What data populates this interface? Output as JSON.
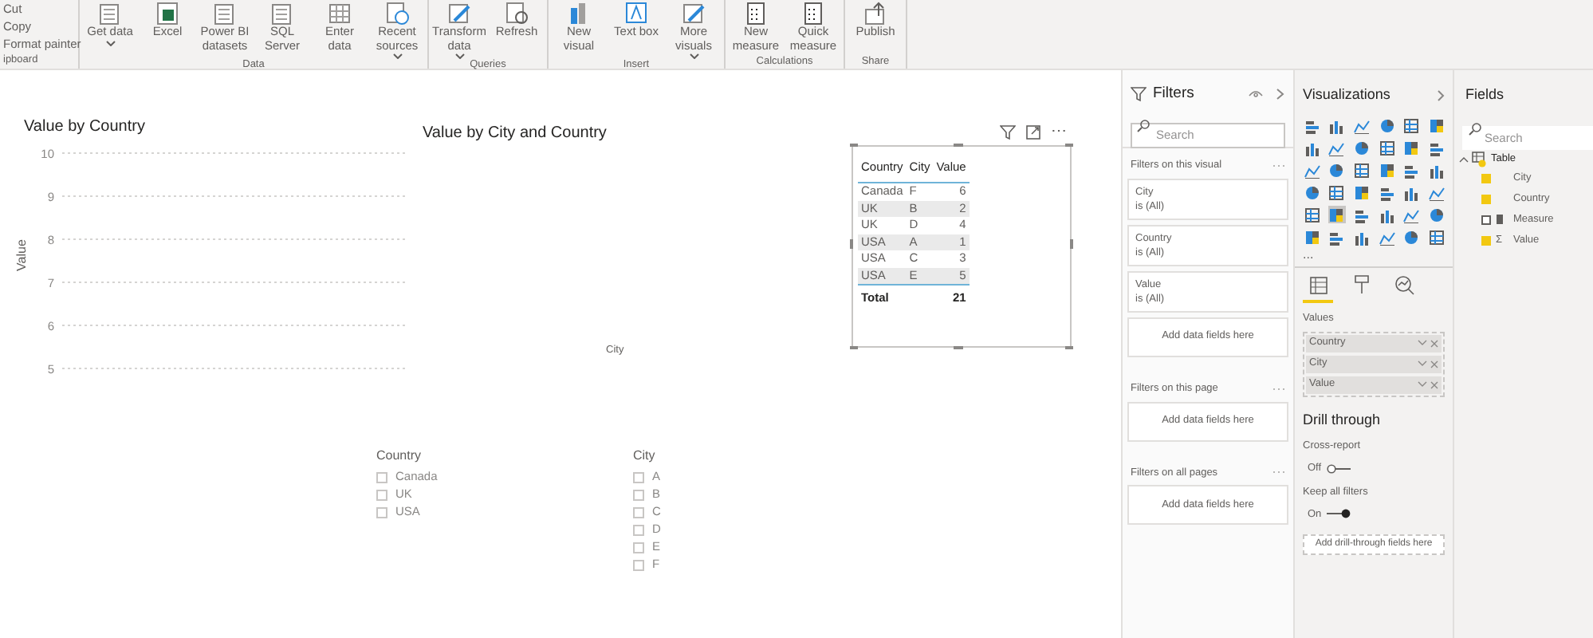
{
  "ribbon": {
    "clipboard": {
      "items": [
        "Cut",
        "Copy",
        "Format painter"
      ],
      "label": "ipboard"
    },
    "groups": [
      {
        "label": "Data",
        "buttons": [
          {
            "label": "Get data",
            "menu": true
          },
          {
            "label": "Excel",
            "menu": false
          },
          {
            "label": "Power BI datasets",
            "menu": false
          },
          {
            "label": "SQL Server",
            "menu": false
          },
          {
            "label": "Enter data",
            "menu": false
          },
          {
            "label": "Recent sources",
            "menu": true
          }
        ]
      },
      {
        "label": "Queries",
        "buttons": [
          {
            "label": "Transform data",
            "menu": true
          },
          {
            "label": "Refresh",
            "menu": false
          }
        ]
      },
      {
        "label": "Insert",
        "buttons": [
          {
            "label": "New visual",
            "menu": false
          },
          {
            "label": "Text box",
            "menu": false
          },
          {
            "label": "More visuals",
            "menu": true
          }
        ]
      },
      {
        "label": "Calculations",
        "buttons": [
          {
            "label": "New measure",
            "menu": false
          },
          {
            "label": "Quick measure",
            "menu": false
          }
        ]
      },
      {
        "label": "Share",
        "buttons": [
          {
            "label": "Publish",
            "menu": false
          }
        ]
      }
    ]
  },
  "canvas": {
    "chart1": {
      "title": "Value by Country",
      "ylabel": "Value",
      "yticks": [
        "10",
        "9",
        "8",
        "7",
        "6",
        "5"
      ]
    },
    "chart2": {
      "title": "Value by City and Country",
      "xlabel": "City"
    },
    "table_visual": {
      "more": "⋯",
      "columns": [
        "Country",
        "City",
        "Value"
      ],
      "rows": [
        [
          "Canada",
          "F",
          "6"
        ],
        [
          "UK",
          "B",
          "2"
        ],
        [
          "UK",
          "D",
          "4"
        ],
        [
          "USA",
          "A",
          "1"
        ],
        [
          "USA",
          "C",
          "3"
        ],
        [
          "USA",
          "E",
          "5"
        ]
      ],
      "total": {
        "label": "Total",
        "value": "21"
      }
    },
    "slicers": [
      {
        "title": "Country",
        "items": [
          {
            "label": "Canada",
            "checked": false
          },
          {
            "label": "UK",
            "checked": false
          },
          {
            "label": "USA",
            "checked": false
          }
        ]
      },
      {
        "title": "City",
        "items": [
          {
            "label": "A",
            "checked": false
          },
          {
            "label": "B",
            "checked": false
          },
          {
            "label": "C",
            "checked": false
          },
          {
            "label": "D",
            "checked": false
          },
          {
            "label": "E",
            "checked": false
          },
          {
            "label": "F",
            "checked": false
          }
        ]
      }
    ]
  },
  "filters": {
    "title": "Filters",
    "search": {
      "placeholder": "Search"
    },
    "sections": [
      {
        "title": "Filters on this visual",
        "cards": [
          {
            "field": "City",
            "condition": "is (All)"
          },
          {
            "field": "Country",
            "condition": "is (All)"
          },
          {
            "field": "Value",
            "condition": "is (All)"
          }
        ],
        "add": "Add data fields here"
      },
      {
        "title": "Filters on this page",
        "add": "Add data fields here"
      },
      {
        "title": "Filters on all pages",
        "add": "Add data fields here"
      }
    ]
  },
  "visualizations": {
    "title": "Visualizations",
    "types": [
      {
        "selected": false
      },
      {
        "selected": false
      },
      {
        "selected": false
      },
      {
        "selected": false
      },
      {
        "selected": false
      },
      {
        "selected": false
      },
      {
        "selected": false
      },
      {
        "selected": false
      },
      {
        "selected": false
      },
      {
        "selected": false
      },
      {
        "selected": false
      },
      {
        "selected": false
      },
      {
        "selected": false
      },
      {
        "selected": false
      },
      {
        "selected": false
      },
      {
        "selected": false
      },
      {
        "selected": false
      },
      {
        "selected": false
      },
      {
        "selected": false
      },
      {
        "selected": false
      },
      {
        "selected": false
      },
      {
        "selected": false
      },
      {
        "selected": false
      },
      {
        "selected": false
      },
      {
        "selected": false
      },
      {
        "selected": true
      },
      {
        "selected": false
      },
      {
        "selected": false
      },
      {
        "selected": false
      },
      {
        "selected": false
      },
      {
        "selected": false
      },
      {
        "selected": false
      },
      {
        "selected": false
      },
      {
        "selected": false
      },
      {
        "selected": false
      },
      {
        "selected": false
      }
    ],
    "more": "...",
    "tabs": [
      {
        "kind": "fields",
        "selected": true
      },
      {
        "kind": "format",
        "selected": false
      },
      {
        "kind": "analytics",
        "selected": false
      }
    ],
    "values_label": "Values",
    "wells": [
      "Country",
      "City",
      "Value"
    ],
    "drill_title": "Drill through",
    "toggles": [
      {
        "label": "Cross-report",
        "state": "Off",
        "on": false
      },
      {
        "label": "Keep all filters",
        "state": "On",
        "on": true
      }
    ],
    "drill_add": "Add drill-through fields here"
  },
  "fields": {
    "title": "Fields",
    "search": {
      "placeholder": "Search"
    },
    "tree": [
      {
        "label": "Table",
        "expanded": true,
        "children": [
          {
            "label": "City",
            "kind": "column",
            "checked": true
          },
          {
            "label": "Country",
            "kind": "column",
            "checked": true
          },
          {
            "label": "Measure",
            "kind": "measure",
            "checked": false
          },
          {
            "label": "Value",
            "kind": "sum",
            "sigma": "Σ",
            "checked": true
          }
        ]
      }
    ]
  }
}
